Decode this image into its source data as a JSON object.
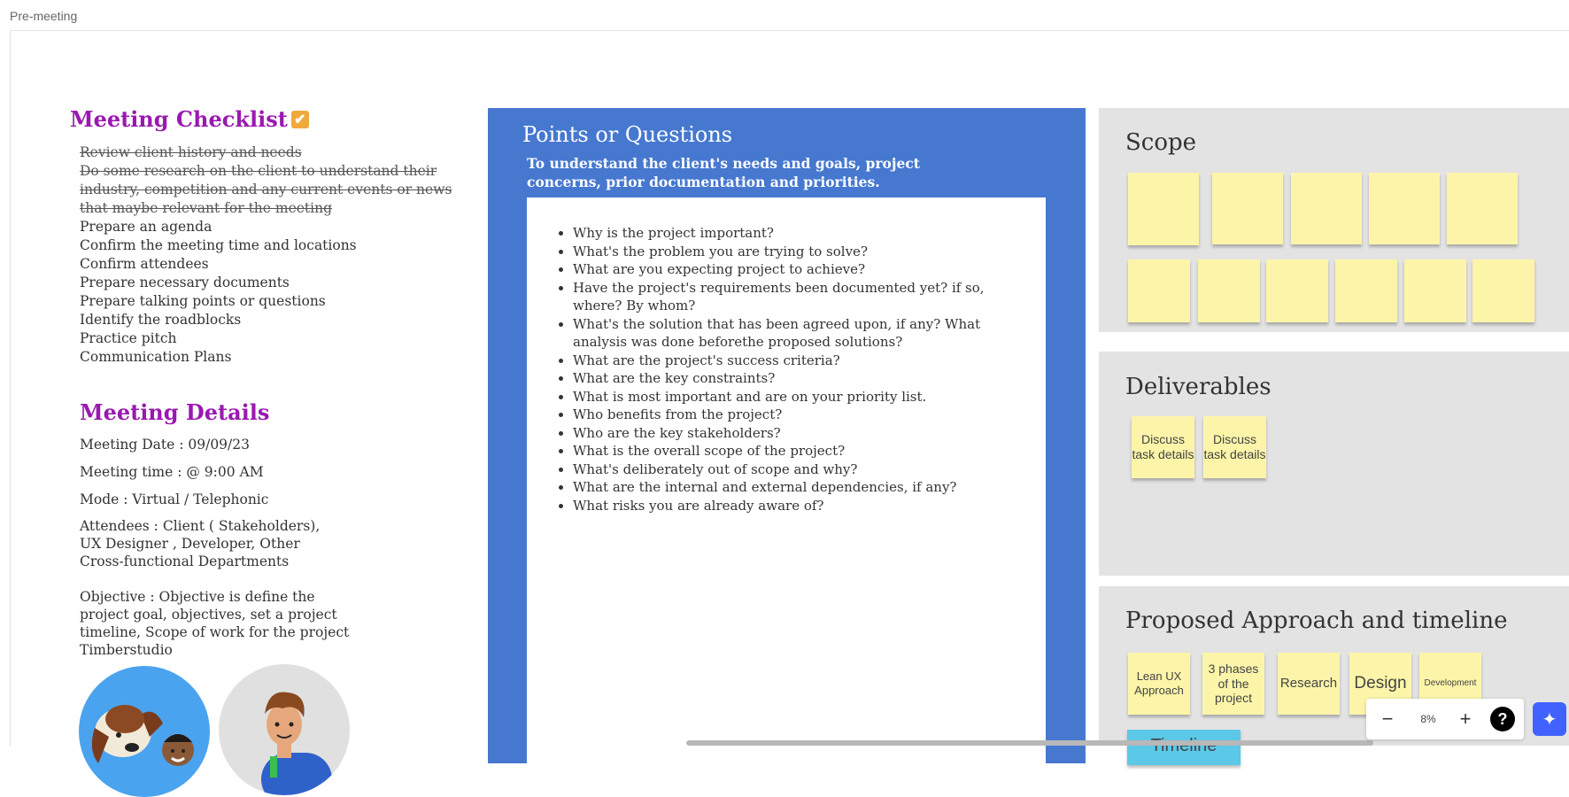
{
  "frame": {
    "title": "Pre-meeting"
  },
  "checklist": {
    "title": "Meeting Checklist",
    "items": [
      {
        "text": "Review client history and needs",
        "done": true
      },
      {
        "text": "Do some research on the client to understand their industry, competition and any current events or news that maybe relevant for the meeting",
        "done": true
      },
      {
        "text": "Prepare an agenda",
        "done": false
      },
      {
        "text": "Confirm the meeting time and locations",
        "done": false
      },
      {
        "text": "Confirm attendees",
        "done": false
      },
      {
        "text": "Prepare necessary documents",
        "done": false
      },
      {
        "text": "Prepare talking points or questions",
        "done": false
      },
      {
        "text": "Identify the roadblocks",
        "done": false
      },
      {
        "text": "Practice pitch",
        "done": false
      },
      {
        "text": "Communication Plans",
        "done": false
      }
    ]
  },
  "details": {
    "title": "Meeting  Details",
    "date": "Meeting Date : 09/09/23",
    "time": "Meeting time : @ 9:00 AM",
    "mode": "Mode : Virtual / Telephonic",
    "attendees": "Attendees : Client ( Stakeholders), UX Designer , Developer, Other Cross-functional Departments",
    "objective": "Objective : Objective is define the project goal, objectives, set a project timeline, Scope of work for the project Timberstudio"
  },
  "points": {
    "title": "Points or Questions",
    "subtitle": "To understand the client's needs and goals, project concerns, prior documentation and priorities.",
    "questions": [
      "Why is the project important?",
      "What's the problem you are trying to solve?",
      "What are you expecting project to achieve?",
      "Have the project's requirements been documented yet? if so, where? By whom?",
      "What's the solution that has been agreed upon, if any? What analysis was done beforethe proposed solutions?",
      "What are the project's success criteria?",
      "What are the key constraints?",
      "What is most important and are on your priority list.",
      "Who benefits from the project?",
      "Who are the key stakeholders?",
      "What is the overall scope of the project?",
      "What's deliberately out of scope and why?",
      "What are the internal and external dependencies, if any?",
      "What risks you are already aware of?"
    ]
  },
  "scope": {
    "title": "Scope"
  },
  "deliverables": {
    "title": "Deliverables",
    "notes": [
      "Discuss task details",
      "Discuss task details"
    ]
  },
  "approach": {
    "title": "Proposed Approach and timeline",
    "notes": [
      "Lean UX Approach",
      "3 phases of the project",
      "Research",
      "Design",
      "Development"
    ],
    "timeline_label": "Timeline"
  },
  "zoom": {
    "minus": "−",
    "level": "8%",
    "plus": "+",
    "help": "?"
  },
  "colors": {
    "accent_purple": "#9a19b0",
    "panel_blue": "#4778d0",
    "sticky_yellow": "#fcf5a9",
    "panel_gray": "#e3e3e3"
  }
}
